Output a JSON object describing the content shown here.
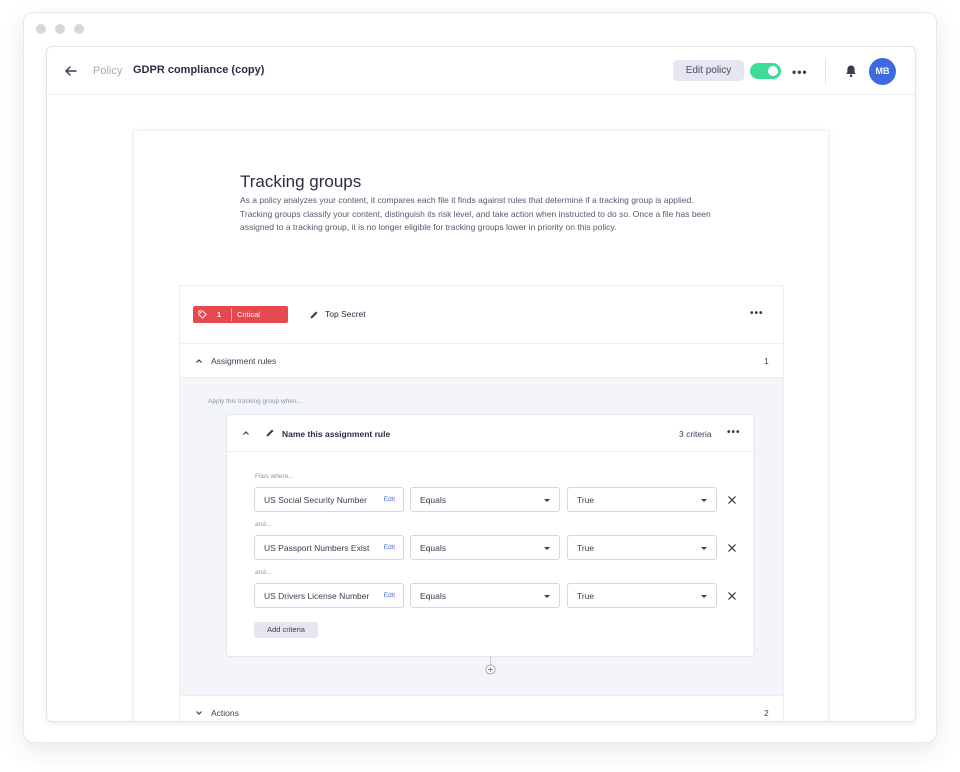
{
  "header": {
    "breadcrumb_parent": "Policy",
    "title": "GDPR compliance (copy)",
    "edit_policy_label": "Edit policy",
    "toggle_on": true,
    "avatar_initials": "MB",
    "accent_color": "#3ddc97",
    "avatar_color": "#3c6bde"
  },
  "intro": {
    "title": "Tracking groups",
    "description": "As a policy analyzes your content, it compares each file it finds against rules that determine if a tracking group is applied. Tracking groups classify your content, distinguish its risk level, and take action when instructed to do so. Once a file has been assigned to a tracking group, it is no longer eligible for tracking groups lower in priority on this policy."
  },
  "group": {
    "priority": "1",
    "risk_level": "Critical",
    "risk_color": "#e5484d",
    "name": "Top Secret",
    "assignment_rules_label": "Assignment rules",
    "assignment_rules_count": "1",
    "apply_label": "Apply this tracking group when...",
    "rule": {
      "name": "Name this assignment rule",
      "criteria_count": "3 criteria",
      "files_where_label": "Files where...",
      "and_label": "and...",
      "criteria": [
        {
          "field": "US Social Security Number",
          "edit_label": "Edit",
          "operator": "Equals",
          "value": "True"
        },
        {
          "field": "US Passport Numbers Exist",
          "edit_label": "Edit",
          "operator": "Equals",
          "value": "True"
        },
        {
          "field": "US Drivers License Number",
          "edit_label": "Edit",
          "operator": "Equals",
          "value": "True"
        }
      ],
      "add_criteria_label": "Add criteria"
    },
    "actions_label": "Actions",
    "actions_count": "2"
  }
}
